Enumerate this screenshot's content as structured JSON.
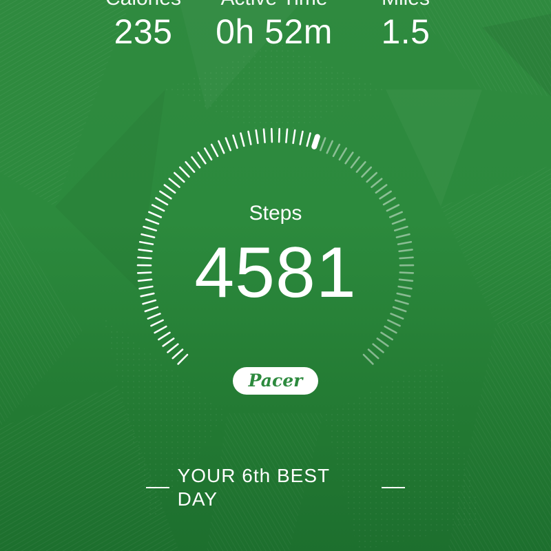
{
  "stats": {
    "calories": {
      "label": "Calories",
      "value": "235"
    },
    "active_time": {
      "label": "Active Time",
      "value": "0h 52m"
    },
    "miles": {
      "label": "Miles",
      "value": "1.5"
    }
  },
  "steps": {
    "label": "Steps",
    "value": "4581",
    "progress": 0.57
  },
  "brand": {
    "name": "Pacer"
  },
  "ranking": {
    "text": "YOUR 6th BEST DAY"
  },
  "colors": {
    "background": "#2c8a3d",
    "tick_active": "#ffffff",
    "tick_inactive": "rgba(255,255,255,0.45)",
    "badge_text": "#2d8a3e"
  }
}
